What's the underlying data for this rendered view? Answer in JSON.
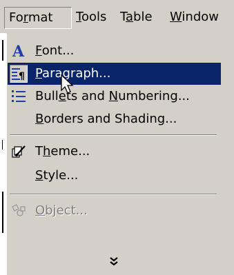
{
  "menubar": {
    "items": [
      {
        "pre": "Fo",
        "ul": "r",
        "post": "mat"
      },
      {
        "pre": "",
        "ul": "T",
        "post": "ools"
      },
      {
        "pre": "T",
        "ul": "a",
        "post": "ble"
      },
      {
        "pre": "",
        "ul": "W",
        "post": "indow"
      }
    ]
  },
  "menu": {
    "font": {
      "pre": "",
      "ul": "F",
      "post": "ont..."
    },
    "paragraph": {
      "pre": "",
      "ul": "P",
      "post": "aragraph..."
    },
    "bullets": {
      "pre": "Bull",
      "ul": "e",
      "post": "ts and ",
      "pre2": "",
      "ul2": "N",
      "post2": "umbering..."
    },
    "borders": {
      "pre": "",
      "ul": "B",
      "post": "orders and Shading..."
    },
    "theme": {
      "pre": "T",
      "ul": "h",
      "post": "eme..."
    },
    "style": {
      "pre": "",
      "ul": "S",
      "post": "tyle..."
    },
    "object": {
      "pre": "",
      "ul": "O",
      "post": "bject..."
    }
  },
  "colors": {
    "menu_bg": "#d4d0c8",
    "highlight": "#0a246a",
    "icon_blue": "#1f3fa8"
  },
  "icons": {
    "font": "font-a-icon",
    "paragraph": "paragraph-icon",
    "bullets": "bullets-list-icon",
    "theme": "theme-brush-icon",
    "object": "object-icon",
    "expand": "chevron-double-down-icon"
  }
}
